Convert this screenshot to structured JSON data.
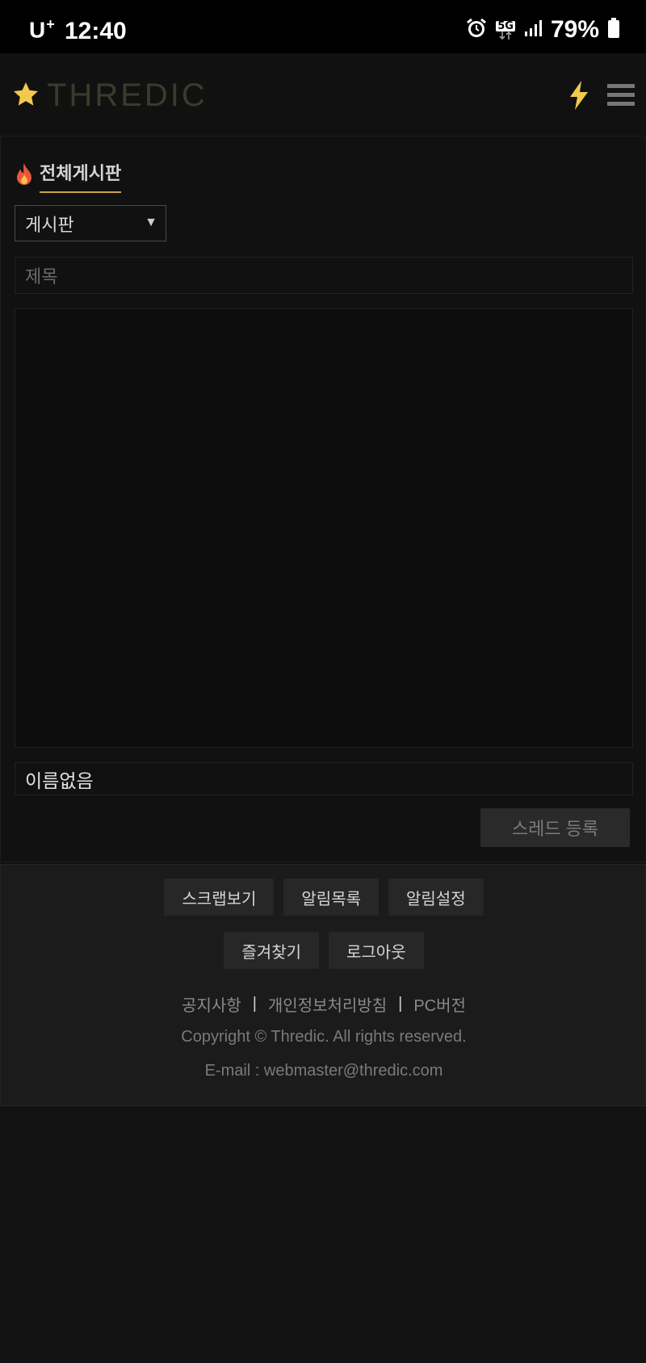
{
  "status_bar": {
    "carrier": "U",
    "carrier_sup": "+",
    "time": "12:40",
    "network": "5G",
    "battery": "79%",
    "icons": [
      "alarm-icon",
      "5g-icon",
      "signal-icon",
      "battery-icon"
    ]
  },
  "header": {
    "logo_text": "THREDIC",
    "logo_icon": "star-icon",
    "actions": [
      "lightning-icon",
      "menu-icon"
    ]
  },
  "board": {
    "icon": "fire-icon",
    "title": "전체게시판",
    "select_value": "게시판",
    "title_placeholder": "제목",
    "content_value": "",
    "name_value": "이름없음",
    "submit_label": "스레드 등록"
  },
  "footer": {
    "buttons_row1": [
      "스크랩보기",
      "알림목록",
      "알림설정"
    ],
    "buttons_row2": [
      "즐겨찾기",
      "로그아웃"
    ],
    "links": [
      "공지사항",
      "개인정보처리방침",
      "PC버전"
    ],
    "link_separator": "|",
    "copyright": "Copyright © Thredic. All rights reserved.",
    "email": "E-mail : webmaster@thredic.com"
  },
  "colors": {
    "background": "#121212",
    "accent_gold": "#c9a24e",
    "star": "#f2c94c",
    "logo_text": "#3b3a2c"
  }
}
